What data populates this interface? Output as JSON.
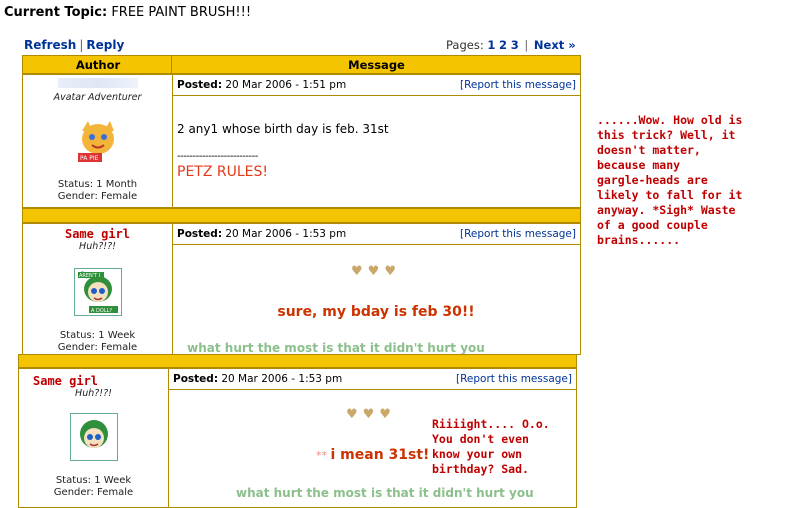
{
  "topic": {
    "label": "Current Topic:",
    "title": "FREE PAINT BRUSH!!!"
  },
  "nav": {
    "refresh": "Refresh",
    "reply": "Reply",
    "pages_label": "Pages:",
    "pages": [
      "1",
      "2",
      "3"
    ],
    "next": "Next »"
  },
  "table": {
    "author_header": "Author",
    "message_header": "Message"
  },
  "posts": [
    {
      "author_title": "Avatar Adventurer",
      "avatar_badge": "PA PIE",
      "status": "Status: 1 Month",
      "gender": "Gender: Female",
      "posted_label": "Posted:",
      "posted": "20 Mar 2006 - 1:51 pm",
      "report": "[Report this message]",
      "body_line": "2 any1 whose birth day is feb. 31st",
      "sig_rule": "--------------------------",
      "sig": "PETZ RULES!"
    },
    {
      "author_name": "Same girl",
      "author_title": "Huh?!?!",
      "avatar_badge_top": "AREN'T I",
      "avatar_badge_bottom": "A DOLL?",
      "status": "Status: 1 Week",
      "gender": "Gender: Female",
      "posted_label": "Posted:",
      "posted": "20 Mar 2006 - 1:53 pm",
      "report": "[Report this message]",
      "hearts": "♥♥♥",
      "body_line": "sure, my bday is feb 30!!",
      "sig": "what hurt the most is that it didn't hurt you"
    },
    {
      "author_name": "Same girl",
      "author_title": "Huh?!?!",
      "status": "Status: 1 Week",
      "gender": "Gender: Female",
      "posted_label": "Posted:",
      "posted": "20 Mar 2006 - 1:53 pm",
      "report": "[Report this message]",
      "hearts": "♥♥♥",
      "body_prefix": "**",
      "body_line": "i mean 31st!",
      "sig": "what hurt the most is that it didn't hurt you"
    }
  ],
  "notes": {
    "side": "......Wow. How old is\nthis trick? Well, it\ndoesn't matter,\nbecause many\ngargle-heads are\nlikely to fall for it\nanyway. *Sigh* Waste\nof a good couple\nbrains......",
    "inline": "Riiiight.... O.o.\nYou don't even\nknow your own\nbirthday? Sad."
  },
  "colors": {
    "accent": "#f5c400",
    "link": "#003399",
    "note": "#c00000"
  }
}
